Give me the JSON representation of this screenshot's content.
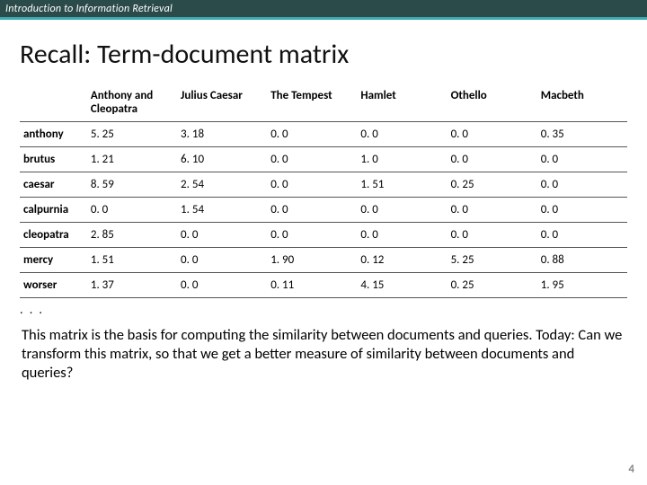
{
  "header": {
    "course": "Introduction to Information Retrieval"
  },
  "title": "Recall: Term-document matrix",
  "chart_data": {
    "type": "table",
    "title": "Term-document matrix",
    "columns": [
      "Anthony and Cleopatra",
      "Julius Caesar",
      "The Tempest",
      "Hamlet",
      "Othello",
      "Macbeth"
    ],
    "rows": [
      "anthony",
      "brutus",
      "caesar",
      "calpurnia",
      "cleopatra",
      "mercy",
      "worser"
    ],
    "values": [
      [
        "5. 25",
        "3. 18",
        "0. 0",
        "0. 0",
        "0. 0",
        "0. 35"
      ],
      [
        "1. 21",
        "6. 10",
        "0. 0",
        "1. 0",
        "0. 0",
        "0. 0"
      ],
      [
        "8. 59",
        " 2. 54",
        "0. 0",
        "1. 51",
        "0. 25",
        "0. 0"
      ],
      [
        "0. 0",
        "1. 54",
        "0. 0",
        "0. 0",
        "0. 0",
        "0. 0"
      ],
      [
        "2. 85",
        "0. 0",
        "0. 0",
        "0. 0",
        " 0. 0",
        "0. 0"
      ],
      [
        "1. 51",
        "0. 0",
        "1. 90",
        "0. 12",
        "5. 25",
        "0. 88"
      ],
      [
        "1. 37",
        "0. 0",
        "0. 11",
        "4. 15",
        "0. 25",
        "1. 95"
      ]
    ]
  },
  "ellipsis": ". . .",
  "caption": "This matrix is the basis for computing the similarity between documents and queries. Today: Can we transform this matrix, so that we get a better measure of similarity between documents and queries?",
  "page_number": "4"
}
